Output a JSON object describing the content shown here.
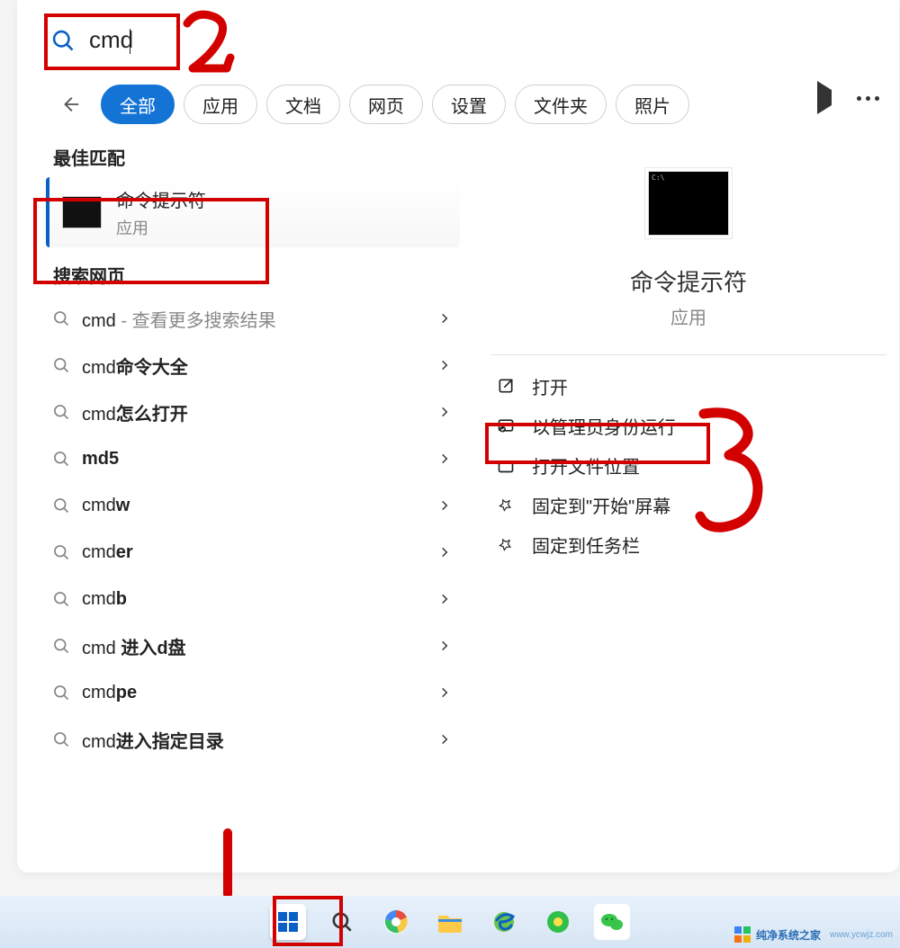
{
  "search": {
    "value": "cmd"
  },
  "filters": {
    "items": [
      "全部",
      "应用",
      "文档",
      "网页",
      "设置",
      "文件夹",
      "照片"
    ],
    "active": "全部"
  },
  "annotations": {
    "a1": "1",
    "a2": "2",
    "a3": "3"
  },
  "best_match": {
    "title": "最佳匹配",
    "name": "命令提示符",
    "subtitle": "应用"
  },
  "web_search": {
    "title": "搜索网页",
    "items": [
      {
        "prefix": "cmd",
        "bold": "",
        "suffix": " - 查看更多搜索结果"
      },
      {
        "prefix": "cmd",
        "bold": "命令大全",
        "suffix": ""
      },
      {
        "prefix": "cmd",
        "bold": "怎么打开",
        "suffix": ""
      },
      {
        "prefix": "",
        "bold": "md5",
        "suffix": ""
      },
      {
        "prefix": "cmd",
        "bold": "w",
        "suffix": ""
      },
      {
        "prefix": "cmd",
        "bold": "er",
        "suffix": ""
      },
      {
        "prefix": "cmd",
        "bold": "b",
        "suffix": ""
      },
      {
        "prefix": "cmd ",
        "bold": "进入d盘",
        "suffix": ""
      },
      {
        "prefix": "cmd",
        "bold": "pe",
        "suffix": ""
      },
      {
        "prefix": "cmd",
        "bold": "进入指定目录",
        "suffix": ""
      }
    ]
  },
  "detail": {
    "name": "命令提示符",
    "subtitle": "应用",
    "actions": [
      {
        "icon": "open",
        "label": "打开"
      },
      {
        "icon": "admin",
        "label": "以管理员身份运行"
      },
      {
        "icon": "folder",
        "label": "打开文件位置"
      },
      {
        "icon": "pin",
        "label": "固定到\"开始\"屏幕"
      },
      {
        "icon": "pin",
        "label": "固定到任务栏"
      }
    ]
  },
  "taskbar": {
    "icons": [
      "start",
      "search",
      "browser",
      "explorer",
      "ie",
      "360",
      "wechat"
    ]
  },
  "watermark": {
    "name": "纯净系统之家",
    "url": "www.ycwjz.com"
  }
}
